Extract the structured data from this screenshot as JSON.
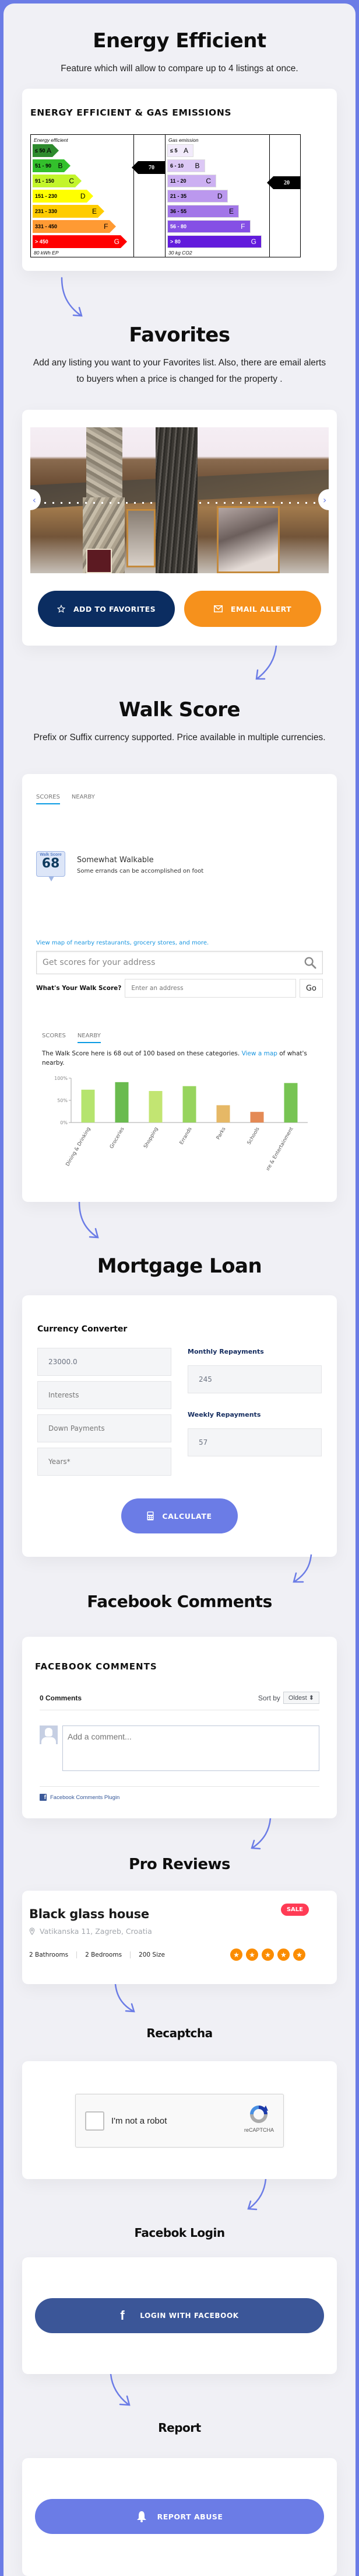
{
  "colors": {
    "frame": "#6b7ce6",
    "page_bg": "#f0f0f5",
    "accent": "#6b7ce6",
    "navy": "#0b2d61",
    "orange": "#f6911c",
    "facebook": "#3b5698",
    "sale": "#ff3b55",
    "star": "#fb8c00",
    "link": "#1a96e0"
  },
  "energy": {
    "title": "Energy Efficient",
    "subtitle": "Feature which will allow to compare up to 4 listings at once.",
    "card_title": "ENERGY EFFICIENT & GAS EMISSIONS",
    "energy_label": "Energy efficient",
    "energy_footer": "80 kWh EP",
    "energy_marker": "70",
    "energy_marker_band": "B",
    "energy_bands": [
      {
        "range": "≤ 50",
        "letter": "A",
        "color": "#2e8b2e"
      },
      {
        "range": "51 - 90",
        "letter": "B",
        "color": "#33c02c"
      },
      {
        "range": "91 - 150",
        "letter": "C",
        "color": "#c3f52b"
      },
      {
        "range": "151 - 230",
        "letter": "D",
        "color": "#ffff00"
      },
      {
        "range": "231 - 330",
        "letter": "E",
        "color": "#ffcc00"
      },
      {
        "range": "331 - 450",
        "letter": "F",
        "color": "#ff9a33"
      },
      {
        "range": "> 450",
        "letter": "G",
        "color": "#ff0000"
      }
    ],
    "gas_label": "Gas emission",
    "gas_footer": "30 kg CO2",
    "gas_marker": "20",
    "gas_marker_band": "C",
    "gas_bands": [
      {
        "range": "≤ 5",
        "letter": "A",
        "color": "#f2ebfb"
      },
      {
        "range": "6 - 10",
        "letter": "B",
        "color": "#dcc8f5"
      },
      {
        "range": "11 - 20",
        "letter": "C",
        "color": "#ccb0f2"
      },
      {
        "range": "21 - 35",
        "letter": "D",
        "color": "#bb98ee"
      },
      {
        "range": "36 - 55",
        "letter": "E",
        "color": "#a276e8"
      },
      {
        "range": "56 - 80",
        "letter": "F",
        "color": "#8550e5"
      },
      {
        "range": "> 80",
        "letter": "G",
        "color": "#621bdc"
      }
    ]
  },
  "favorites": {
    "title": "Favorites",
    "subtitle": "Add any listing you want to your Favorites list. Also, there are email alerts to buyers when a price is changed for the property .",
    "prev_icon": "‹",
    "next_icon": "›",
    "add_label": "ADD TO FAVORITES",
    "email_label": "EMAIL ALLERT"
  },
  "walkscore": {
    "title": "Walk Score",
    "subtitle": "Prefix or Suffix currency supported. Price available in multiple currencies.",
    "tabs": [
      "SCORES",
      "NEARBY"
    ],
    "active_tab_top": 0,
    "badge_label": "Walk Score",
    "score": "68",
    "rating": "Somewhat Walkable",
    "rating_desc": "Some errands can be accomplished on foot",
    "map_link": "View map of nearby restaurants, grocery stores, and more.",
    "search_placeholder": "Get scores for your address",
    "go_label": "What's Your Walk Score?",
    "go_placeholder": "Enter an address",
    "go_button": "Go",
    "active_tab_bottom": 1,
    "sentence_pre": "The Walk Score here is 68 out of 100 based on these categories. ",
    "sentence_link": "View a map",
    "sentence_post": " of what's nearby."
  },
  "chart_data": {
    "type": "bar",
    "title": "",
    "xlabel": "",
    "ylabel": "",
    "ylim": [
      0,
      100
    ],
    "yticks": [
      "0%",
      "50%",
      "100%"
    ],
    "categories": [
      "Dining & Drinking",
      "Groceries",
      "Shopping",
      "Errands",
      "Parks",
      "Schools",
      "Culture & Entertainment"
    ],
    "values": [
      74,
      91,
      71,
      82,
      39,
      24,
      89
    ],
    "colors": [
      "#b5e46e",
      "#6abb4f",
      "#c2e572",
      "#97d45e",
      "#e6b866",
      "#e48a55",
      "#77c453"
    ],
    "grid": false
  },
  "mortgage": {
    "title": "Mortgage Loan",
    "card_title": "Currency Converter",
    "fields": [
      {
        "value": "23000.0",
        "placeholder": ""
      },
      {
        "value": "",
        "placeholder": "Interests"
      },
      {
        "value": "",
        "placeholder": "Down Payments"
      },
      {
        "value": "",
        "placeholder": "Years*"
      }
    ],
    "monthly_label": "Monthly Repayments",
    "monthly_value": "245",
    "weekly_label": "Weekly Repayments",
    "weekly_value": "57",
    "calc_label": "CALCULATE"
  },
  "fbcomments": {
    "title": "Facebook Comments",
    "card_title": "FACEBOOK COMMENTS",
    "count": "0 Comments",
    "sort_label": "Sort by",
    "sort_value": "Oldest ⬍",
    "placeholder": "Add a comment...",
    "plugin": "Facebook Comments Plugin"
  },
  "reviews": {
    "title": "Pro Reviews",
    "listing_title": "Black glass house",
    "badge": "SALE",
    "address": "Vatikanska 11, Zagreb, Croatia",
    "facts": [
      "2 Bathrooms",
      "2 Bedrooms",
      "200 Size"
    ],
    "rating": 5,
    "rating_max": 5
  },
  "recaptcha": {
    "title": "Recaptcha",
    "label": "I'm not a robot",
    "brand": "reCAPTCHA"
  },
  "fblogin": {
    "title": "Facebok Login",
    "button": "LOGIN WITH FACEBOOK"
  },
  "report": {
    "title": "Report",
    "button": "REPORT ABUSE"
  }
}
